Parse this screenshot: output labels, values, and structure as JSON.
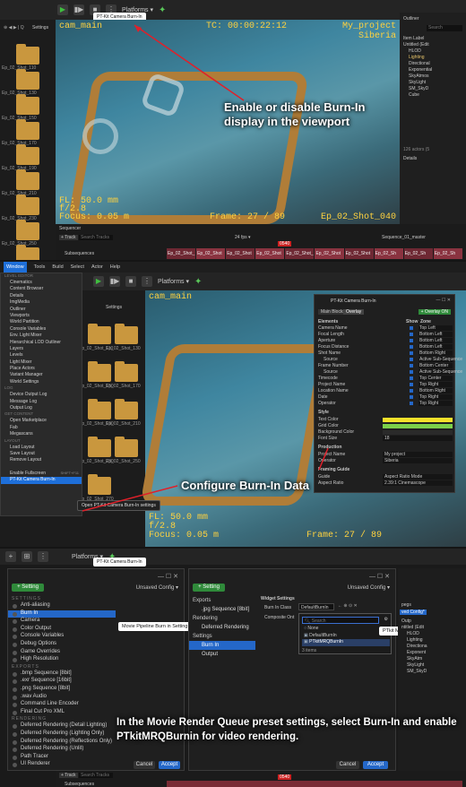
{
  "panel1": {
    "toolbar": {
      "platforms": "Platforms ▾",
      "tooltip": "PT-Kit Camera Burn-In"
    },
    "browser": {
      "settings": "Settings",
      "folders": [
        "Ep_02_Shot_110",
        "Ep_02_Shot_130",
        "Ep_02_Shot_150",
        "Ep_02_Shot_170",
        "Ep_02_Shot_190",
        "Ep_02_Shot_210",
        "Ep_02_Shot_230",
        "Ep_02_Shot_250",
        "Ep_02_Shot_270"
      ]
    },
    "viewport": {
      "camera": "cam_main",
      "timecode": "TC: 00:00:22:12",
      "project": "My_project",
      "location": "Siberia",
      "fl": "FL: 50.0 mm",
      "aperture": "f/2.8",
      "focus": "Focus: 0.05 m",
      "frame": "Frame: 27 / 89",
      "shot": "Ep_02_Shot_040"
    },
    "callout": "Enable or disable Burn-In display in the viewport",
    "outliner": {
      "title": "Outliner",
      "search": "Search",
      "items": [
        "Item Label",
        "Untitled (Edit",
        "HLOD",
        "Lighting",
        "Directional",
        "Exponential",
        "SkyAtmos",
        "SkyLight",
        "SM_SkyD",
        "Cube"
      ],
      "count": "126 actors (5",
      "details": "Details"
    },
    "sequencer": {
      "title": "Sequencer",
      "track": "+ Track",
      "search": "Search Tracks",
      "fps": "24 fps ▾",
      "frame": "0540",
      "seq": "Sequence_01_master",
      "subseq": "Subsequences",
      "shots": [
        "Ep_02_Shot_",
        "Ep_02_Shot",
        "Ep_02_Shot",
        "Ep_02_Shot",
        "Ep_02_Shot_",
        "Ep_02_Shot",
        "Ep_02_Shot",
        "Ep_02_Sh",
        "Ep_02_Sh",
        "Ep_02_Sh"
      ]
    }
  },
  "panel2": {
    "menubar": [
      "Window",
      "Tools",
      "Build",
      "Select",
      "Actor",
      "Help"
    ],
    "menu": [
      {
        "t": "h",
        "l": "LEVEL EDITOR"
      },
      {
        "t": "i",
        "l": "Cinematics"
      },
      {
        "t": "i",
        "l": "Content Browser"
      },
      {
        "t": "i",
        "l": "Details"
      },
      {
        "t": "i",
        "l": "ImgMedia"
      },
      {
        "t": "i",
        "l": "Outliner"
      },
      {
        "t": "i",
        "l": "Viewports"
      },
      {
        "t": "i",
        "l": "World Partition"
      },
      {
        "t": "i",
        "l": "Console Variables"
      },
      {
        "t": "i",
        "l": "Env. Light Mixer"
      },
      {
        "t": "i",
        "l": "Hierarchical LOD Outliner"
      },
      {
        "t": "i",
        "l": "Layers"
      },
      {
        "t": "i",
        "l": "Levels"
      },
      {
        "t": "i",
        "l": "Light Mixer"
      },
      {
        "t": "i",
        "l": "Place Actors"
      },
      {
        "t": "i",
        "l": "Variant Manager"
      },
      {
        "t": "i",
        "l": "World Settings"
      },
      {
        "t": "h",
        "l": "LOG"
      },
      {
        "t": "i",
        "l": "Device Output Log"
      },
      {
        "t": "i",
        "l": "Message Log"
      },
      {
        "t": "i",
        "l": "Output Log"
      },
      {
        "t": "h",
        "l": "GET CONTENT"
      },
      {
        "t": "i",
        "l": "Open Marketplace"
      },
      {
        "t": "i",
        "l": "Fab"
      },
      {
        "t": "i",
        "l": "Megascans"
      },
      {
        "t": "h",
        "l": "LAYOUT"
      },
      {
        "t": "i",
        "l": "Load Layout"
      },
      {
        "t": "i",
        "l": "Save Layout"
      },
      {
        "t": "i",
        "l": "Remove Layout"
      },
      {
        "t": "h",
        "l": ""
      },
      {
        "t": "i",
        "l": "Enable Fullscreen",
        "k": "SHIFT+F11"
      },
      {
        "t": "s",
        "l": "PT-Kit Camera Burn-In"
      }
    ],
    "tooltip": "Open PT-Kit Camera Burn-In settings",
    "platforms": "Platforms ▾",
    "settings": "Settings",
    "folders": [
      "Ep_02_Shot_110",
      "Ep_02_Shot_130",
      "Ep_02_Shot_150",
      "Ep_02_Shot_170",
      "Ep_02_Shot_190",
      "Ep_02_Shot_210",
      "Ep_02_Shot_230",
      "Ep_02_Shot_250",
      "Ep_02_Shot_270"
    ],
    "viewport": {
      "camera": "cam_main",
      "fl": "FL: 50.0 mm",
      "aperture": "f/2.8",
      "focus": "Focus: 0.05 m",
      "frame": "Frame: 27 / 89"
    },
    "dialog": {
      "title": "PT-Kit Camera Burn-In",
      "tabs": [
        "Main Blocks",
        "Overlay"
      ],
      "overlay_btn": "+ Overlay ON",
      "cols": {
        "el": "Elements",
        "show": "Show",
        "zone": "Zone"
      },
      "rows": [
        [
          "Camera Name",
          "Top Left"
        ],
        [
          "Focal Length",
          "Bottom Left"
        ],
        [
          "Aperture",
          "Bottom Left"
        ],
        [
          "Focus Distance",
          "Bottom Left"
        ],
        [
          "Shot Name",
          "Bottom Right"
        ],
        [
          "Source",
          "Active Sub-Sequence"
        ],
        [
          "Frame Number",
          "Bottom Center"
        ],
        [
          "Source",
          "Active Sub-Sequence"
        ],
        [
          "Timecode",
          "Top Center"
        ],
        [
          "Project Name",
          "Top Right"
        ],
        [
          "Location Name",
          "Bottom Right"
        ],
        [
          "Date",
          "Top Right"
        ],
        [
          "Operator",
          "Top Right"
        ]
      ],
      "style": {
        "hdr": "Style",
        "rows": [
          "Text Color",
          "Grid Color",
          "Background Color",
          "Font Size"
        ],
        "font_size": "18"
      },
      "production": {
        "hdr": "Production",
        "rows": [
          [
            "Project Name",
            "My project"
          ],
          [
            "Operator",
            "Siberia"
          ]
        ]
      },
      "framing": {
        "hdr": "Framing Guide",
        "rows": [
          [
            "Guide",
            "Aspect Ratio Mode"
          ],
          [
            "Aspect Ratio",
            "2.39:1 Cinemascope"
          ]
        ]
      },
      "colors": {
        "text": "#f4e12a",
        "grid": "#7cd04a",
        "bg": "#2a2a2a"
      }
    },
    "callout": "Configure Burn-In Data"
  },
  "panel3": {
    "left_dialog": {
      "add": "+ Setting",
      "unsaved": "Unsaved Config ▾",
      "groups": [
        {
          "h": "SETTINGS",
          "items": [
            "Anti-aliasing",
            "Burn In",
            "Camera",
            "Color Output",
            "Console Variables",
            "Debug Options",
            "Game Overrides",
            "High Resolution"
          ]
        },
        {
          "h": "EXPORTS",
          "items": [
            ".bmp Sequence [8bit]",
            ".exr Sequence [16bit]",
            ".png Sequence [8bit]",
            ".wav Audio",
            "Command Line Encoder",
            "Final Cut Pro XML"
          ]
        },
        {
          "h": "RENDERING",
          "items": [
            "Deferred Rendering (Detail Lighting)",
            "Deferred Rendering (Lighting Only)",
            "Deferred Rendering (Reflections Only)",
            "Deferred Rendering (Unlit)",
            "Path Tracer",
            "UI Renderer"
          ]
        }
      ],
      "selected": "Burn In",
      "tooltip": "Movie Pipeline Burn in Setting",
      "cancel": "Cancel",
      "accept": "Accept"
    },
    "right_dialog": {
      "add": "+ Setting",
      "unsaved": "Unsaved Config ▾",
      "tree": [
        {
          "h": "Exports"
        },
        {
          "i": ".jpg Sequence [8bit]"
        },
        {
          "h": "Rendering"
        },
        {
          "i": "Deferred Rendering"
        },
        {
          "h": "Settings"
        },
        {
          "i": "Burn In",
          "sel": true
        },
        {
          "i": "Output"
        }
      ],
      "widget_hdr": "Widget Settings",
      "burnin_class": "Burn In Class",
      "class_value": "DefaultBurnIn",
      "composite": "Composite Ont",
      "search": "Search",
      "options": [
        "None",
        "DefaultBurnIn",
        "PTkitMRQBurnIn"
      ],
      "items": "3 items",
      "tooltip": "PTkit MRQBurnIn",
      "cancel": "Cancel",
      "accept": "Accept"
    },
    "far_right": {
      "pegs": "pegs",
      "cfg": "ved Config*",
      "items": [
        "Outp",
        "ntitled (Edit",
        "HLOD",
        "Lighting",
        "Directiona",
        "Exponent",
        "SkyAtm",
        "SkyLight",
        "SM_SkyD"
      ]
    },
    "callout": "In the Movie Render Queue preset settings, select Burn-In and enable PTkitMRQBurnin for video rendering.",
    "platforms": "Platforms ▾",
    "tooltip": "PT-Kit Camera Burn-In",
    "seq": {
      "track": "+ Track",
      "search": "Search Tracks",
      "frame": "0540",
      "subseq": "Subsequences"
    }
  }
}
